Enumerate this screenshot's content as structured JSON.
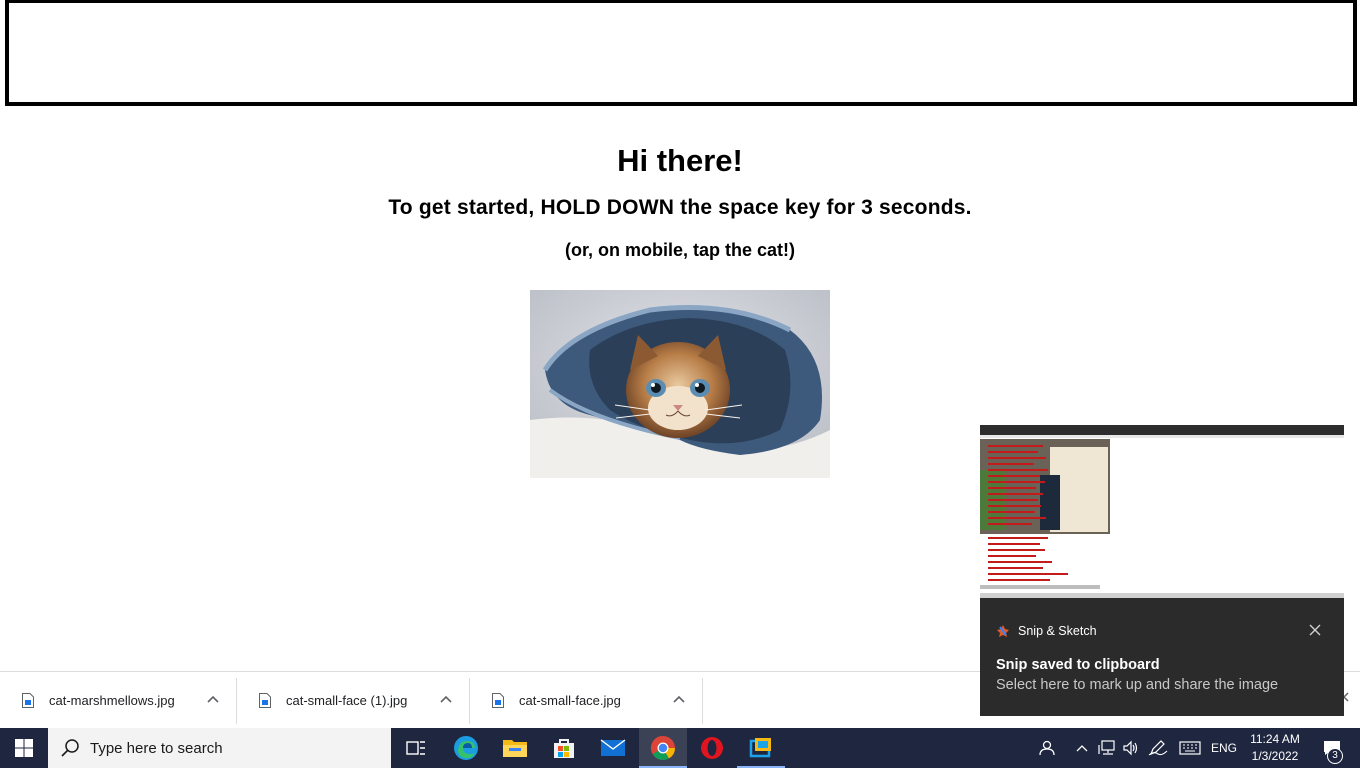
{
  "page": {
    "heading": "Hi there!",
    "instruction": "To get started, HOLD DOWN the space key for 3 seconds.",
    "mobile_hint": "(or, on mobile, tap the cat!)"
  },
  "downloads": {
    "items": [
      {
        "name": "cat-marshmellows.jpg"
      },
      {
        "name": "cat-small-face (1).jpg"
      },
      {
        "name": "cat-small-face.jpg"
      }
    ]
  },
  "toast": {
    "app_name": "Snip & Sketch",
    "title": "Snip saved to clipboard",
    "body": "Select here to mark up and share the image"
  },
  "taskbar": {
    "search_placeholder": "Type here to search",
    "language": "ENG",
    "time": "11:24 AM",
    "date": "1/3/2022",
    "notification_count": "3",
    "pinned_apps": [
      "windows-start",
      "task-view",
      "edge",
      "file-explorer",
      "microsoft-store",
      "mail",
      "chrome",
      "opera",
      "snip-sketch"
    ]
  },
  "colors": {
    "taskbar_bg": "#1f2640",
    "toast_bg": "#2b2b2b",
    "accent": "#0078d4"
  }
}
